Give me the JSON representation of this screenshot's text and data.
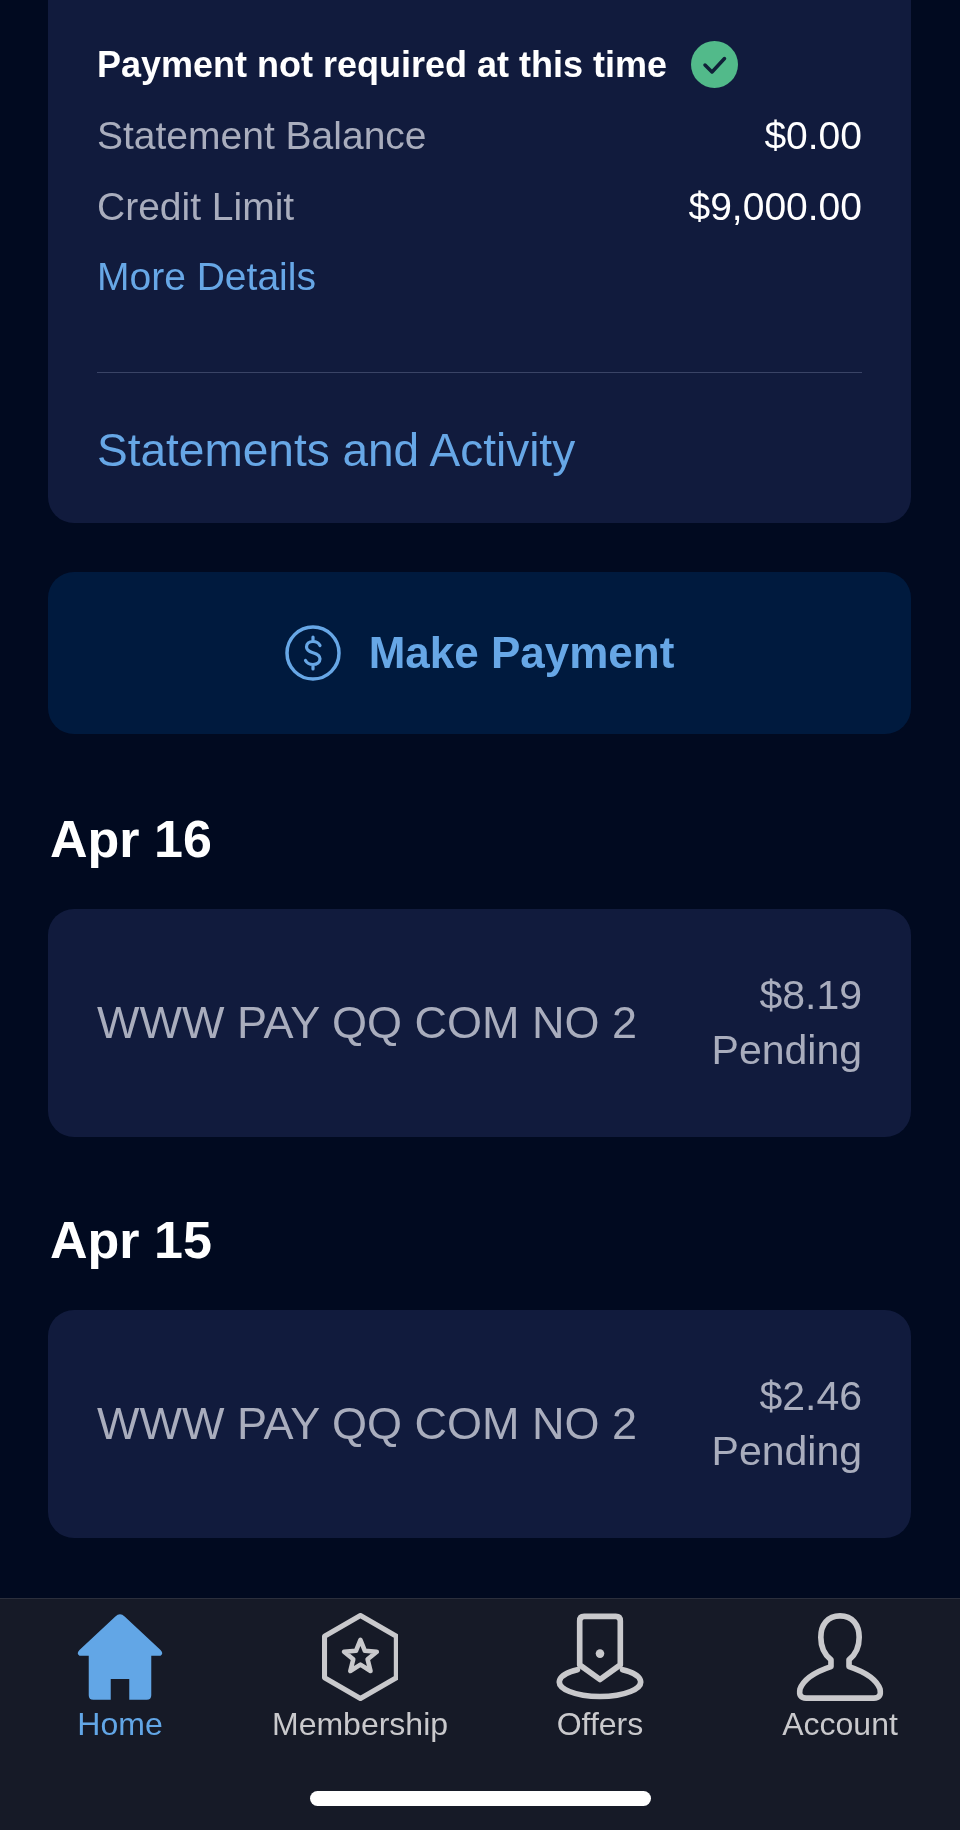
{
  "account_card": {
    "payment_status": "Payment not required at this time",
    "rows": [
      {
        "label": "Statement Balance",
        "value": "$0.00"
      },
      {
        "label": "Credit Limit",
        "value": "$9,000.00"
      }
    ],
    "more_details_link": "More Details",
    "statements_link": "Statements and Activity"
  },
  "make_payment_button": {
    "label": "Make Payment"
  },
  "transaction_groups": [
    {
      "date": "Apr 16",
      "transactions": [
        {
          "merchant": "WWW PAY QQ COM NO 2",
          "amount": "$8.19",
          "status": "Pending"
        }
      ]
    },
    {
      "date": "Apr 15",
      "transactions": [
        {
          "merchant": "WWW PAY QQ COM NO 2",
          "amount": "$2.46",
          "status": "Pending"
        }
      ]
    }
  ],
  "tab_bar": {
    "tabs": [
      {
        "label": "Home",
        "kind": "home",
        "selected": true
      },
      {
        "label": "Membership",
        "kind": "membership",
        "selected": false
      },
      {
        "label": "Offers",
        "kind": "offers",
        "selected": false
      },
      {
        "label": "Account",
        "kind": "account",
        "selected": false
      }
    ]
  }
}
